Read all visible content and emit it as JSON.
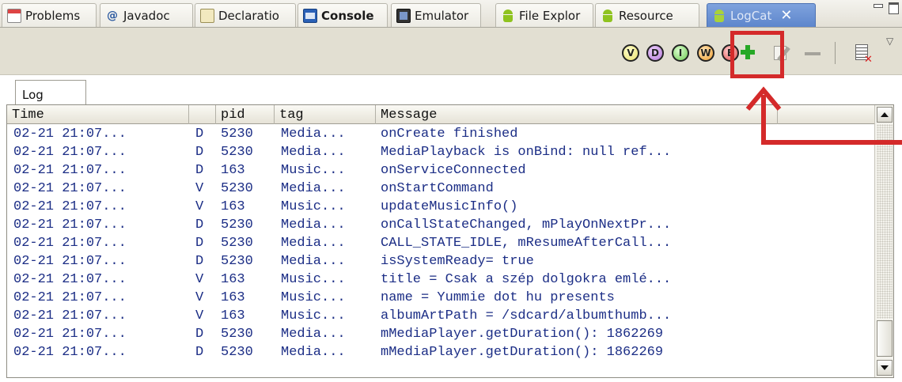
{
  "tabs": [
    {
      "label": "Problems",
      "icon": "problems-icon"
    },
    {
      "label": "Javadoc",
      "icon": "javadoc-icon"
    },
    {
      "label": "Declaratio",
      "icon": "declaration-icon"
    },
    {
      "label": "Console",
      "icon": "console-icon"
    },
    {
      "label": "Emulator",
      "icon": "emulator-icon"
    },
    {
      "label": "File Explor",
      "icon": "android-icon"
    },
    {
      "label": "Resource",
      "icon": "android-icon"
    },
    {
      "label": "LogCat",
      "icon": "android-icon",
      "close": "✕"
    }
  ],
  "toolbar": {
    "levels": [
      {
        "letter": "V",
        "name": "verbose"
      },
      {
        "letter": "D",
        "name": "debug"
      },
      {
        "letter": "I",
        "name": "info"
      },
      {
        "letter": "W",
        "name": "warn"
      },
      {
        "letter": "E",
        "name": "error"
      }
    ],
    "menu_arrow": "▽"
  },
  "log_tab": {
    "label": "Log"
  },
  "table": {
    "columns": [
      "Time",
      "",
      "pid",
      "tag",
      "Message"
    ],
    "rows": [
      {
        "time": "02-21 21:07...",
        "level": "D",
        "pid": "5230",
        "tag": "Media...",
        "message": "onCreate finished"
      },
      {
        "time": "02-21 21:07...",
        "level": "D",
        "pid": "5230",
        "tag": "Media...",
        "message": "MediaPlayback is onBind: null ref..."
      },
      {
        "time": "02-21 21:07...",
        "level": "D",
        "pid": "163",
        "tag": "Music...",
        "message": "onServiceConnected"
      },
      {
        "time": "02-21 21:07...",
        "level": "V",
        "pid": "5230",
        "tag": "Media...",
        "message": "onStartCommand"
      },
      {
        "time": "02-21 21:07...",
        "level": "V",
        "pid": "163",
        "tag": "Music...",
        "message": "updateMusicInfo()"
      },
      {
        "time": "02-21 21:07...",
        "level": "D",
        "pid": "5230",
        "tag": "Media...",
        "message": "onCallStateChanged, mPlayOnNextPr..."
      },
      {
        "time": "02-21 21:07...",
        "level": "D",
        "pid": "5230",
        "tag": "Media...",
        "message": "CALL_STATE_IDLE, mResumeAfterCall..."
      },
      {
        "time": "02-21 21:07...",
        "level": "D",
        "pid": "5230",
        "tag": "Media...",
        "message": "isSystemReady= true"
      },
      {
        "time": "02-21 21:07...",
        "level": "V",
        "pid": "163",
        "tag": "Music...",
        "message": "title = Csak a szép dolgokra emlé..."
      },
      {
        "time": "02-21 21:07...",
        "level": "V",
        "pid": "163",
        "tag": "Music...",
        "message": "name = Yummie dot hu presents"
      },
      {
        "time": "02-21 21:07...",
        "level": "V",
        "pid": "163",
        "tag": "Music...",
        "message": "albumArtPath = /sdcard/albumthumb..."
      },
      {
        "time": "02-21 21:07...",
        "level": "D",
        "pid": "5230",
        "tag": "Media...",
        "message": "mMediaPlayer.getDuration(): 1862269"
      },
      {
        "time": "02-21 21:07...",
        "level": "D",
        "pid": "5230",
        "tag": "Media...",
        "message": "mMediaPlayer.getDuration(): 1862269"
      }
    ]
  },
  "colors": {
    "log_text": "#1c2e86",
    "annotation": "#d42a2a",
    "active_tab": "#5d86cc"
  }
}
